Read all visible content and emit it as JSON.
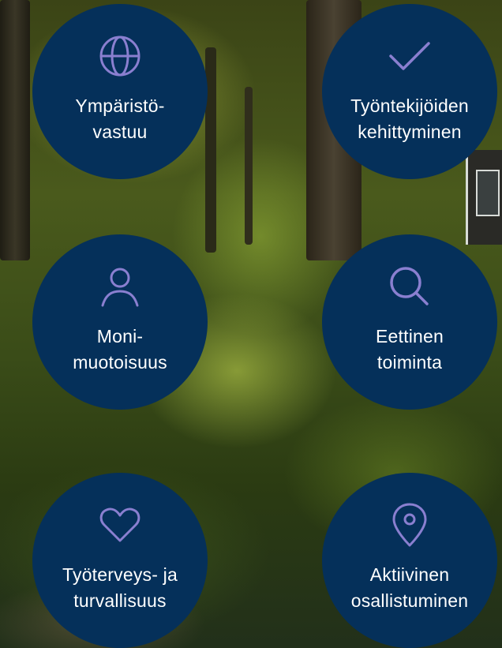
{
  "icon_color": "#8a7fd0",
  "circle_color": "#05305a",
  "items": [
    {
      "icon": "globe-icon",
      "line1": "Ympäristö-",
      "line2": "vastuu"
    },
    {
      "icon": "checkmark-icon",
      "line1": "Työntekijöiden",
      "line2": "kehittyminen"
    },
    {
      "icon": "person-icon",
      "line1": "Moni-",
      "line2": "muotoisuus"
    },
    {
      "icon": "search-icon",
      "line1": "Eettinen",
      "line2": "toiminta"
    },
    {
      "icon": "heart-icon",
      "line1": "Työterveys- ja",
      "line2": "turvallisuus"
    },
    {
      "icon": "location-pin-icon",
      "line1": "Aktiivinen",
      "line2": "osallistuminen"
    }
  ]
}
